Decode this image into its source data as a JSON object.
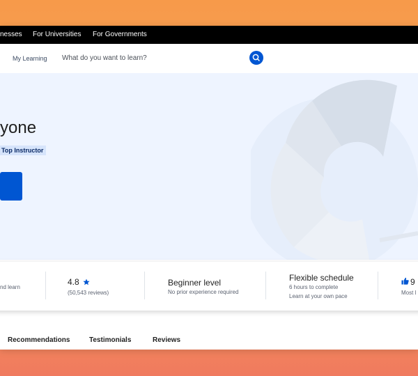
{
  "topbar": {
    "links": [
      "nesses",
      "For Universities",
      "For Governments"
    ]
  },
  "navbar": {
    "my_learning": "My Learning",
    "search_placeholder": "What do you want to learn?"
  },
  "hero": {
    "title": "yone",
    "badge": "Top Instructor"
  },
  "stats": {
    "item1": {
      "sub": "nd learn"
    },
    "rating": {
      "value": "4.8",
      "reviews": "(50,543 reviews)"
    },
    "level": {
      "title": "Beginner level",
      "sub": "No prior experience required"
    },
    "schedule": {
      "title": "Flexible schedule",
      "sub1": "6 hours to complete",
      "sub2": "Learn at your own pace"
    },
    "item5": {
      "value": "9",
      "sub": "Most l"
    }
  },
  "tabs": [
    "Recommendations",
    "Testimonials",
    "Reviews"
  ],
  "colors": {
    "brand_blue": "#0056d2",
    "hero_bg": "#eef4ff",
    "badge_bg": "#d6e4fb"
  }
}
